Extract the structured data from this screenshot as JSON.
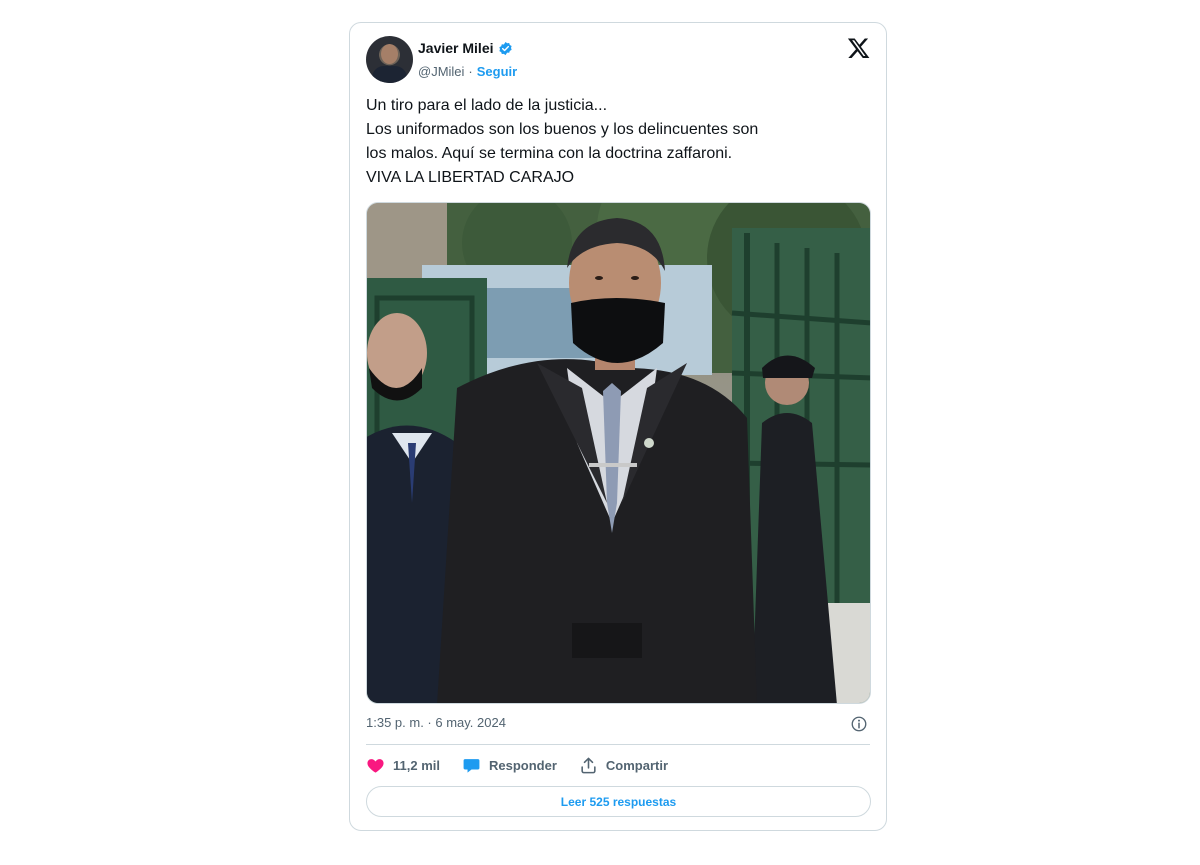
{
  "tweet": {
    "author_name": "Javier Milei",
    "handle": "@JMilei",
    "separator": "·",
    "follow_label": "Seguir",
    "text_lines": [
      "Un tiro para el lado de la justicia...",
      "Los uniformados son los buenos y los delincuentes son",
      "los malos. Aquí se termina con la doctrina zaffaroni.",
      "VIVA LA LIBERTAD CARAJO"
    ],
    "timestamp": "1:35 p. m. · 6 may. 2024",
    "likes": "11,2 mil",
    "reply_label": "Responder",
    "share_label": "Compartir",
    "read_replies_label": "Leer 525 respuestas"
  },
  "icons": {
    "verified": "verified-badge-icon",
    "logo": "x-logo-icon",
    "info": "info-icon",
    "like": "heart-icon",
    "reply": "reply-bubble-icon",
    "share": "share-upload-icon"
  },
  "colors": {
    "accent": "#1d9bf0",
    "like": "#f91880",
    "text": "#0f1419",
    "muted": "#536471",
    "border": "#cfd9de"
  }
}
